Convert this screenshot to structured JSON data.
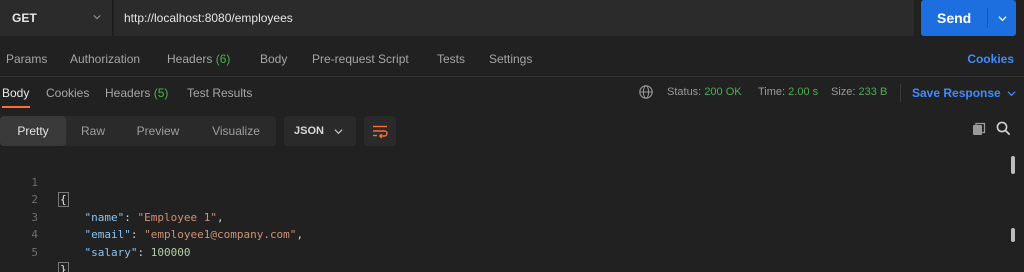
{
  "request": {
    "method": "GET",
    "url": "http://localhost:8080/employees",
    "send_label": "Send"
  },
  "request_tabs": [
    {
      "label": "Params"
    },
    {
      "label": "Authorization"
    },
    {
      "label": "Headers",
      "count": "(6)"
    },
    {
      "label": "Body"
    },
    {
      "label": "Pre-request Script"
    },
    {
      "label": "Tests"
    },
    {
      "label": "Settings"
    }
  ],
  "cookies_label": "Cookies",
  "response_tabs": [
    {
      "label": "Body"
    },
    {
      "label": "Cookies"
    },
    {
      "label": "Headers",
      "count": "(5)"
    },
    {
      "label": "Test Results"
    }
  ],
  "status": {
    "status_label": "Status:",
    "status_value": "200 OK",
    "time_label": "Time:",
    "time_value": "2.00 s",
    "size_label": "Size:",
    "size_value": "233 B"
  },
  "save_response_label": "Save Response",
  "format_options": [
    "Pretty",
    "Raw",
    "Preview",
    "Visualize"
  ],
  "format_selected": "Pretty",
  "language": "JSON",
  "code_lines": [
    {
      "n": "1",
      "open": "{"
    },
    {
      "n": "2",
      "key": "\"name\"",
      "value": "\"Employee 1\"",
      "kind": "str",
      "trail": ","
    },
    {
      "n": "3",
      "key": "\"email\"",
      "value": "\"employee1@company.com\"",
      "kind": "str",
      "trail": ","
    },
    {
      "n": "4",
      "key": "\"salary\"",
      "value": "100000",
      "kind": "num",
      "trail": ""
    },
    {
      "n": "5",
      "close": "}"
    }
  ],
  "colors": {
    "accent_send": "#1d6fe0",
    "link_blue": "#3f8cff",
    "success_green": "#4caf50",
    "active_tab_underline": "#ff6c37"
  },
  "icons": [
    "chevron-down-icon",
    "globe-icon",
    "wrap-lines-icon",
    "copy-icon",
    "search-icon"
  ]
}
